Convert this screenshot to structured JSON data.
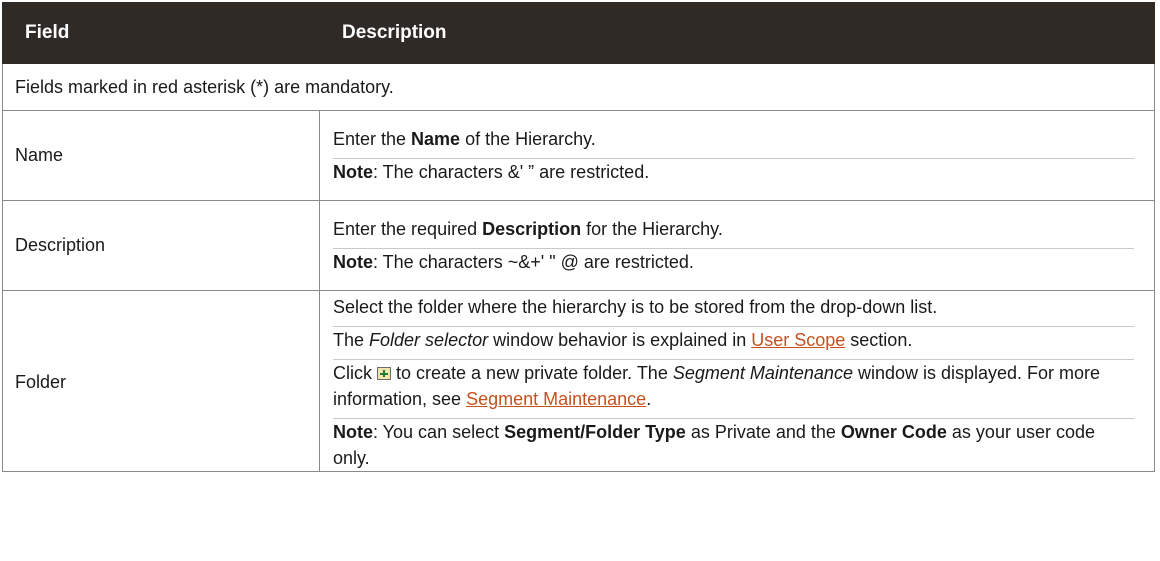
{
  "table": {
    "headers": {
      "field": "Field",
      "description": "Description"
    },
    "mandatory_note": "Fields marked in red asterisk (*) are mandatory.",
    "rows": {
      "name": {
        "field": "Name",
        "line1": {
          "pre": "Enter the ",
          "bold": "Name",
          "post": " of the Hierarchy."
        },
        "note": {
          "label": "Note",
          "text": ": The characters &' ” are restricted."
        }
      },
      "description": {
        "field": "Description",
        "line1": {
          "pre": "Enter the required ",
          "bold": "Description",
          "post": " for the Hierarchy."
        },
        "note": {
          "label": "Note",
          "text": ": The characters ~&+' \" @ are restricted."
        }
      },
      "folder": {
        "field": "Folder",
        "line1": "Select the folder where the hierarchy is to be stored from the drop-down list.",
        "line2": {
          "pre": "The ",
          "italic": "Folder selector",
          "mid": " window behavior is explained in ",
          "link": "User Scope",
          "post": " section."
        },
        "line3": {
          "pre": "Click ",
          "mid": " to create a new private folder. The ",
          "italic": "Segment Maintenance",
          "post": " window is displayed. For more information, see ",
          "link": "Segment Maintenance",
          "end": "."
        },
        "note": {
          "label": "Note",
          "t1": ": You can select ",
          "b1": "Segment/Folder Type",
          "t2": " as Private and the ",
          "b2": "Owner Code",
          "t3": " as your user code only."
        }
      }
    }
  },
  "colors": {
    "header_bg": "#2f2a26",
    "link": "#c9501e"
  },
  "icons": {
    "new_folder": "new-folder-icon"
  }
}
